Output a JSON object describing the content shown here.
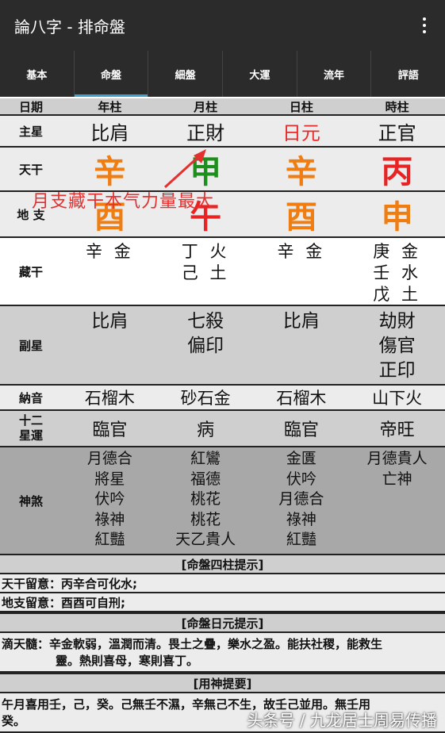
{
  "app": {
    "title": "論八字 - 排命盤"
  },
  "tabs": [
    "基本",
    "命盤",
    "細盤",
    "大運",
    "流年",
    "評語"
  ],
  "active_tab": 1,
  "table": {
    "header": {
      "label": "日期",
      "cols": [
        "年柱",
        "月柱",
        "日柱",
        "時柱"
      ]
    },
    "zhuxing": {
      "label": "主星",
      "vals": [
        "比肩",
        "正財",
        "日元",
        "正官"
      ]
    },
    "tiangan": {
      "label": "天干",
      "vals": [
        "辛",
        "甲",
        "辛",
        "丙"
      ]
    },
    "dizhi": {
      "label": "地 支",
      "vals": [
        "酉",
        "午",
        "酉",
        "申"
      ]
    },
    "zanggan": {
      "label": "藏干",
      "vals": [
        [
          "辛 金"
        ],
        [
          "丁 火",
          "己 土"
        ],
        [
          "辛 金"
        ],
        [
          "庚 金",
          "壬 水",
          "戊 土"
        ]
      ]
    },
    "fuxing": {
      "label": "副星",
      "vals": [
        [
          "比肩"
        ],
        [
          "七殺",
          "偏印"
        ],
        [
          "比肩"
        ],
        [
          "劫財",
          "傷官",
          "正印"
        ]
      ]
    },
    "nayin": {
      "label": "納音",
      "vals": [
        "石榴木",
        "砂石金",
        "石榴木",
        "山下火"
      ]
    },
    "xingyun": {
      "label1": "十二",
      "label2": "星運",
      "vals": [
        "臨官",
        "病",
        "臨官",
        "帝旺"
      ]
    },
    "shensha": {
      "label": "神煞",
      "vals": [
        [
          "月德合",
          "將星",
          "伏吟",
          "祿神",
          "紅豔"
        ],
        [
          "紅鸞",
          "福德",
          "桃花",
          "桃花",
          "天乙貴人"
        ],
        [
          "金匱",
          "伏吟",
          "月德合",
          "祿神",
          "紅豔"
        ],
        [
          "月德貴人",
          "亡神"
        ]
      ]
    }
  },
  "annotation": "月支藏干本气力量最大",
  "sections": {
    "sizhu_title": "[命盤四柱提示]",
    "tiangan_note": "天干留意：丙辛合可化水;",
    "dizhi_note": "地支留意：酉酉可自刑;",
    "riyuan_title": "[命盤日元提示]",
    "ditiansui_line1": "滴天髓：辛金軟弱，溫潤而清。畏土之疊，樂水之盈。能扶社稷，能救生",
    "ditiansui_line2": "靈。熱則喜母，寒則喜丁。",
    "yongshen_title": "[用神提要]",
    "yongshen_line1": "午月喜用壬，己，癸。己無壬不濕，辛無己不生，故壬己並用。無壬用",
    "yongshen_line2": "癸。"
  },
  "watermark": "头条号 / 九龙居士周易传播",
  "colors": {
    "riyuan": "#e52b2b",
    "xin": "#f07d12",
    "jia": "#1c8f1c",
    "bing": "#e82323",
    "you": "#f07d12",
    "wu": "#e82323",
    "shen": "#f07d12",
    "accent": "#3ca3c8"
  }
}
